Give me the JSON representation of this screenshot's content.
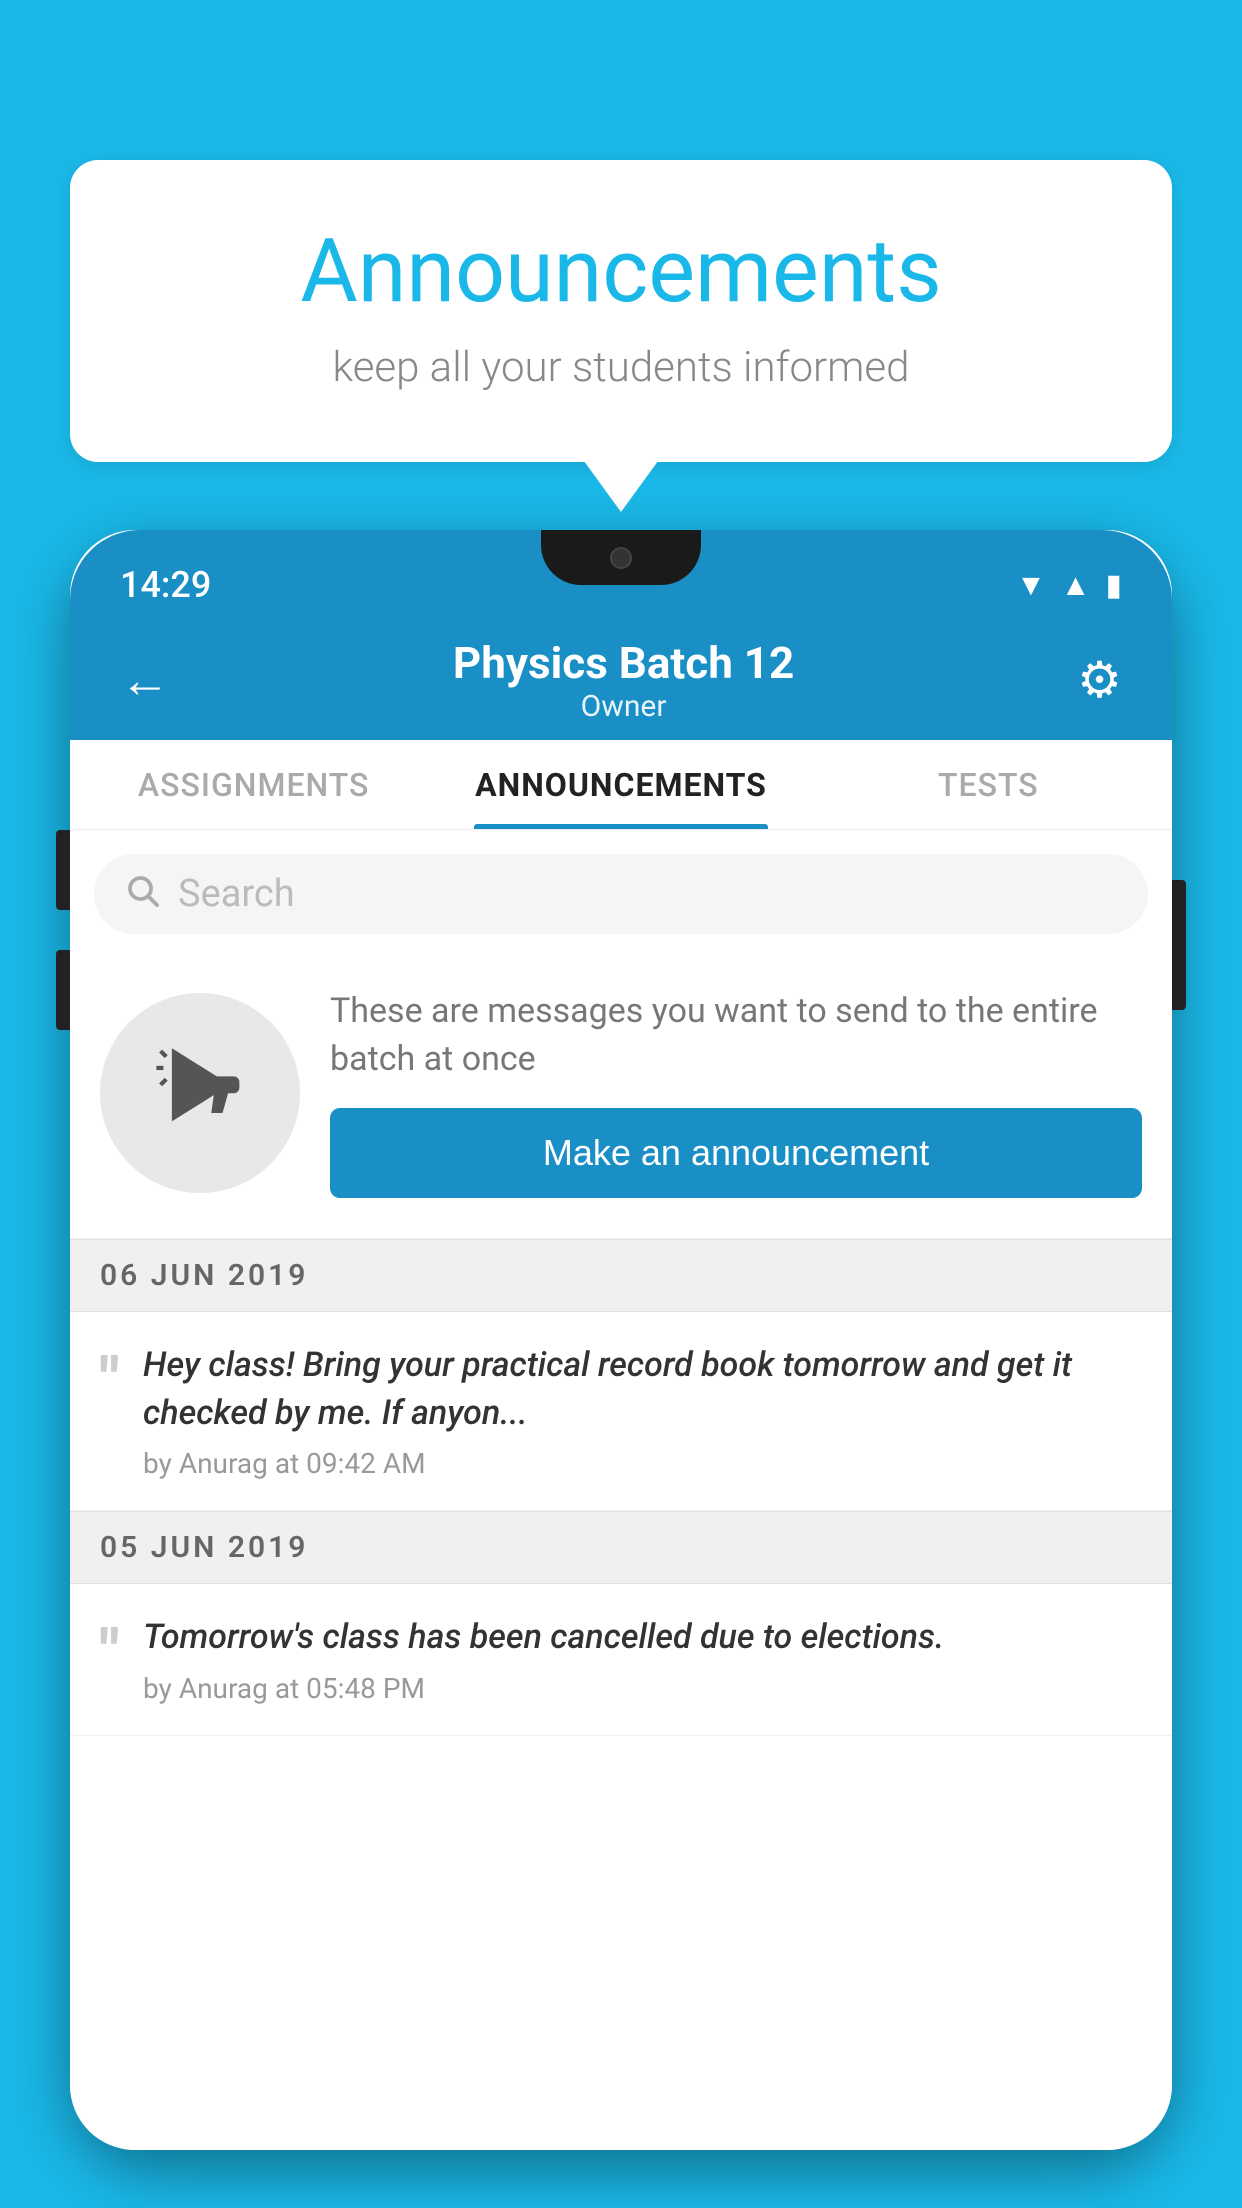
{
  "background_color": "#1ab8e8",
  "speech_bubble": {
    "title": "Announcements",
    "subtitle": "keep all your students informed",
    "title_color": "#1ab8e8",
    "subtitle_color": "#888888"
  },
  "phone": {
    "status_bar": {
      "time": "14:29",
      "icons": [
        "wifi",
        "signal",
        "battery"
      ]
    },
    "header": {
      "title": "Physics Batch 12",
      "subtitle": "Owner",
      "background": "#1a8fc5"
    },
    "tabs": [
      {
        "label": "ASSIGNMENTS",
        "active": false
      },
      {
        "label": "ANNOUNCEMENTS",
        "active": true
      },
      {
        "label": "TESTS",
        "active": false
      }
    ],
    "search": {
      "placeholder": "Search"
    },
    "promo": {
      "description": "These are messages you want to send to the entire batch at once",
      "button_label": "Make an announcement"
    },
    "announcements": [
      {
        "date": "06  JUN  2019",
        "message": "Hey class! Bring your practical record book tomorrow and get it checked by me. If anyon...",
        "author": "by Anurag at 09:42 AM"
      },
      {
        "date": "05  JUN  2019",
        "message": "Tomorrow's class has been cancelled due to elections.",
        "author": "by Anurag at 05:48 PM"
      }
    ]
  }
}
